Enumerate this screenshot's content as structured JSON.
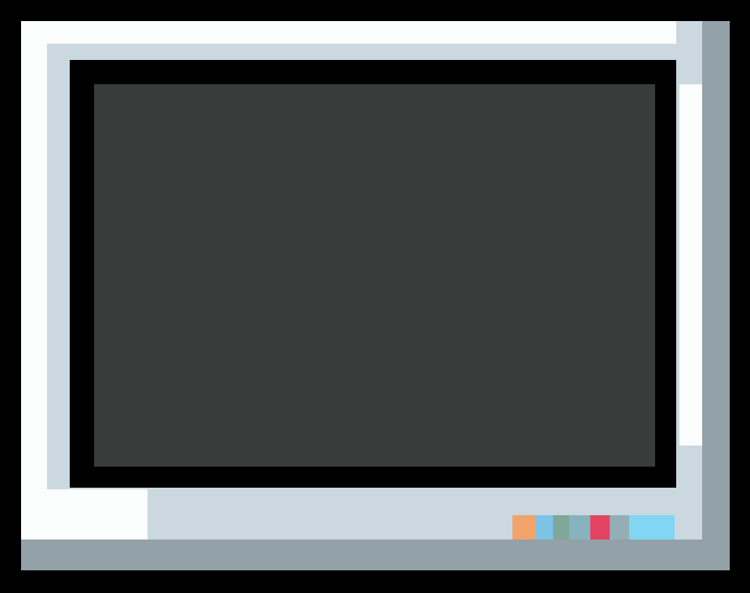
{
  "colors": {
    "frame": "#000000",
    "bezel_highlight": "#fbfcfc",
    "bezel_face": "#cbd8e0",
    "bezel_shadow": "#93a1a8",
    "screen_border": "#000000",
    "screen": "#3a3b3b"
  },
  "indicators": [
    {
      "name": "orange",
      "color": "#f1a36a",
      "width_units": 28
    },
    {
      "name": "sky",
      "color": "#7cc3e6",
      "width_units": 22
    },
    {
      "name": "sage",
      "color": "#7fa79a",
      "width_units": 20
    },
    {
      "name": "teal-grey",
      "color": "#87b3bf",
      "width_units": 26
    },
    {
      "name": "crimson",
      "color": "#e44363",
      "width_units": 24
    },
    {
      "name": "slate",
      "color": "#93aeb4",
      "width_units": 24
    },
    {
      "name": "cyan",
      "color": "#82d6f4",
      "width_units": 56
    }
  ]
}
